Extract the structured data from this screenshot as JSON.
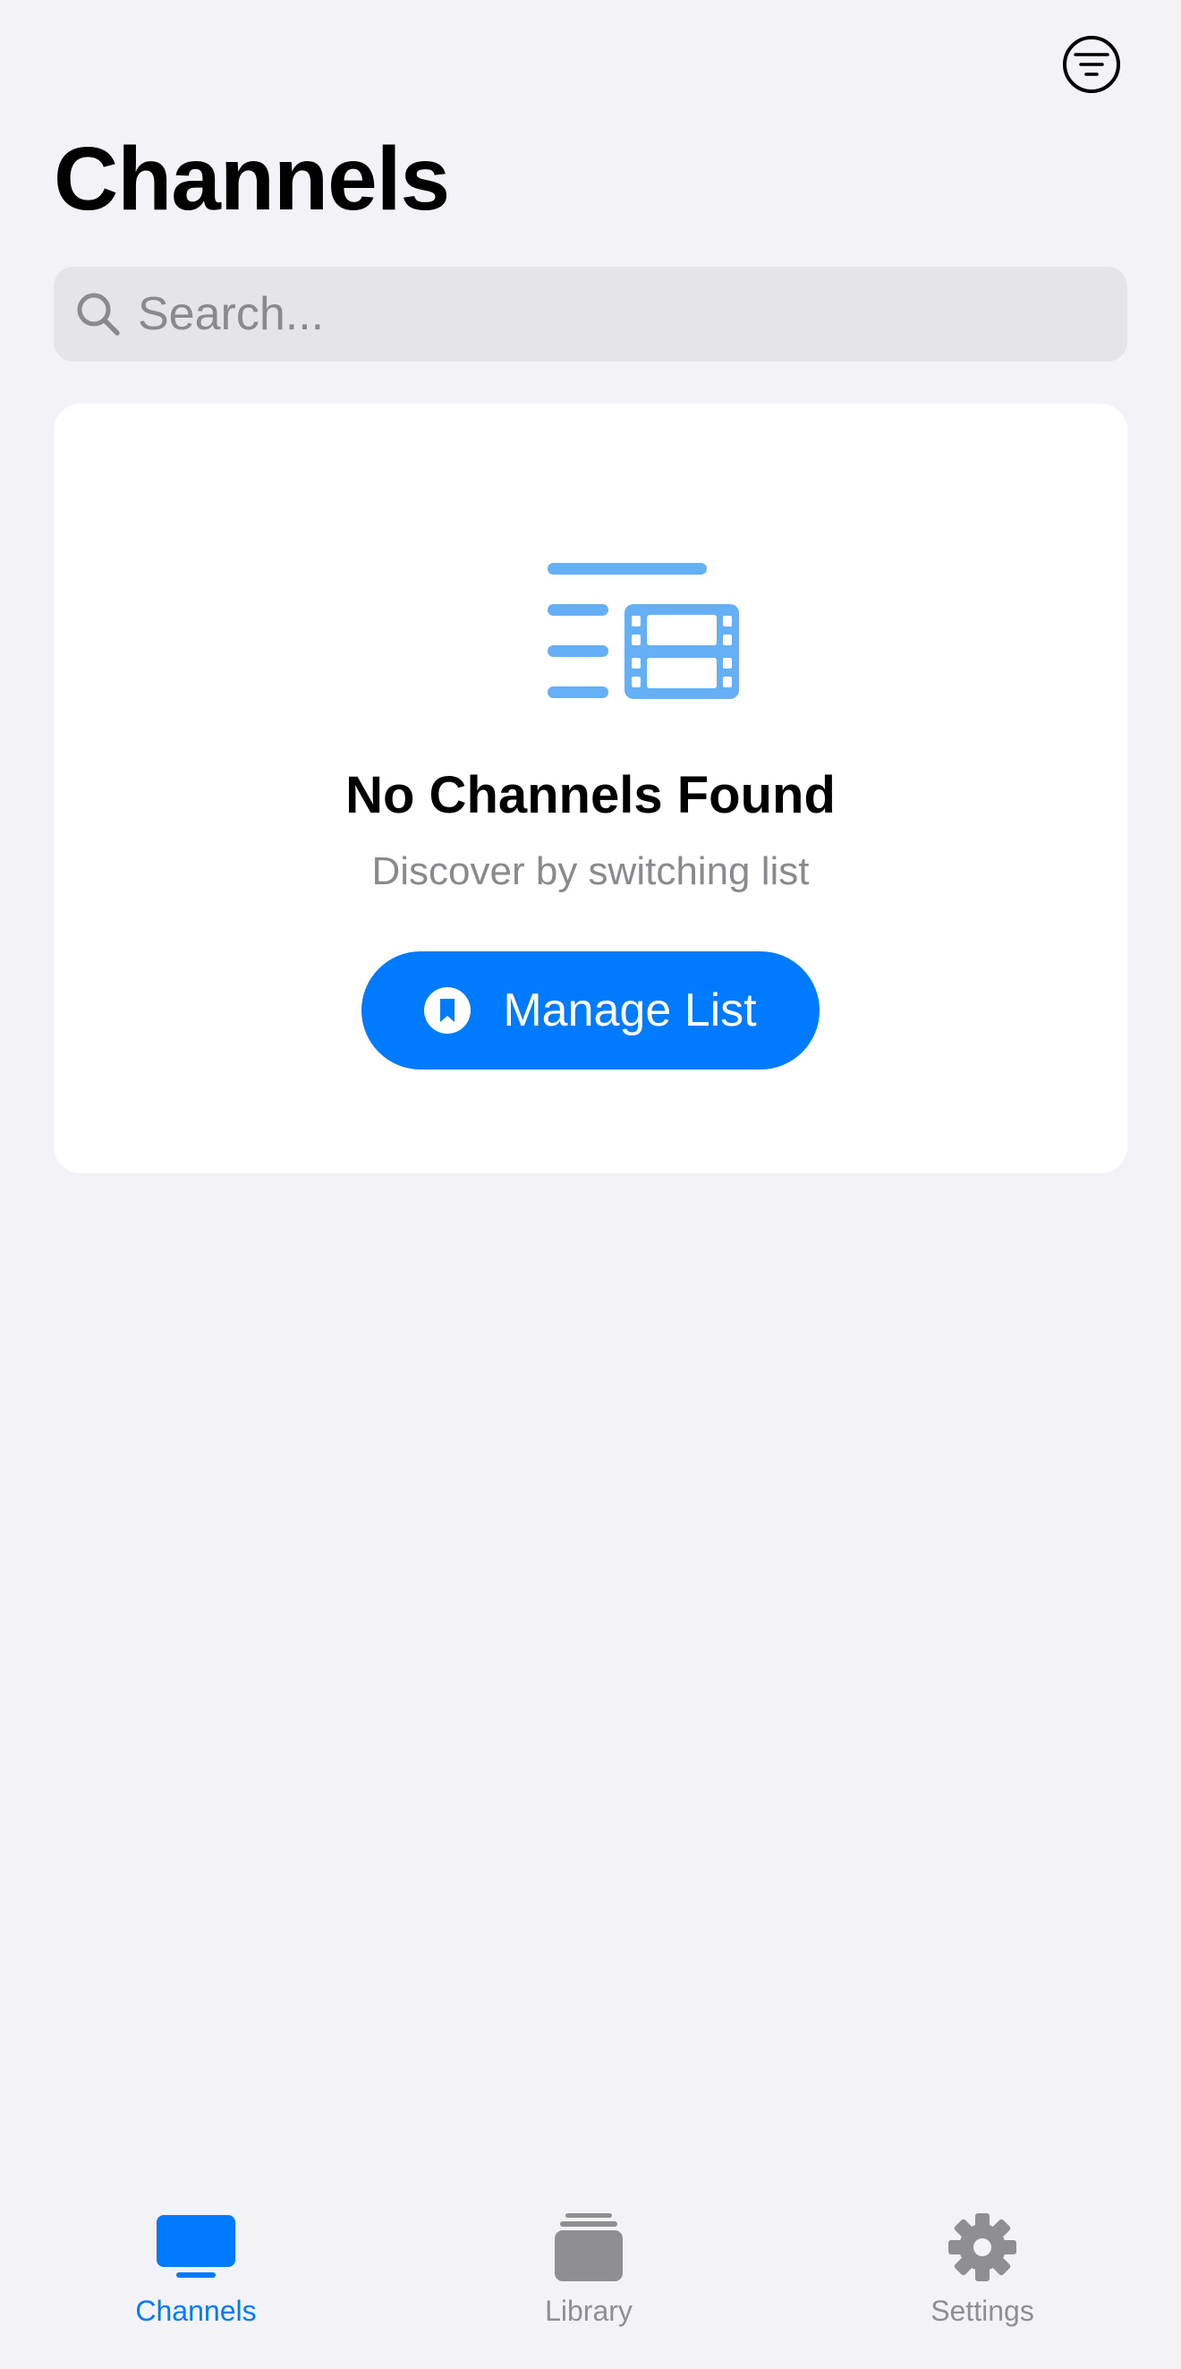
{
  "header": {
    "title": "Channels",
    "filter_icon": "filter-circle-icon"
  },
  "search": {
    "placeholder": "Search...",
    "value": ""
  },
  "empty_state": {
    "icon": "list-and-film-icon",
    "title": "No Channels Found",
    "subtitle": "Discover by switching list",
    "button_label": "Manage List",
    "button_icon": "bookmark-circle-icon"
  },
  "tab_bar": {
    "active": "Channels",
    "items": [
      {
        "label": "Channels",
        "icon": "tv-icon"
      },
      {
        "label": "Library",
        "icon": "stacked-folders-icon"
      },
      {
        "label": "Settings",
        "icon": "gear-icon"
      }
    ]
  },
  "colors": {
    "accent": "#007aff",
    "icon_light_blue": "#64aff5",
    "background": "#f2f2f7",
    "card": "#ffffff",
    "secondary_text": "#8a8a8e",
    "inactive_tab": "#8e8e93"
  }
}
